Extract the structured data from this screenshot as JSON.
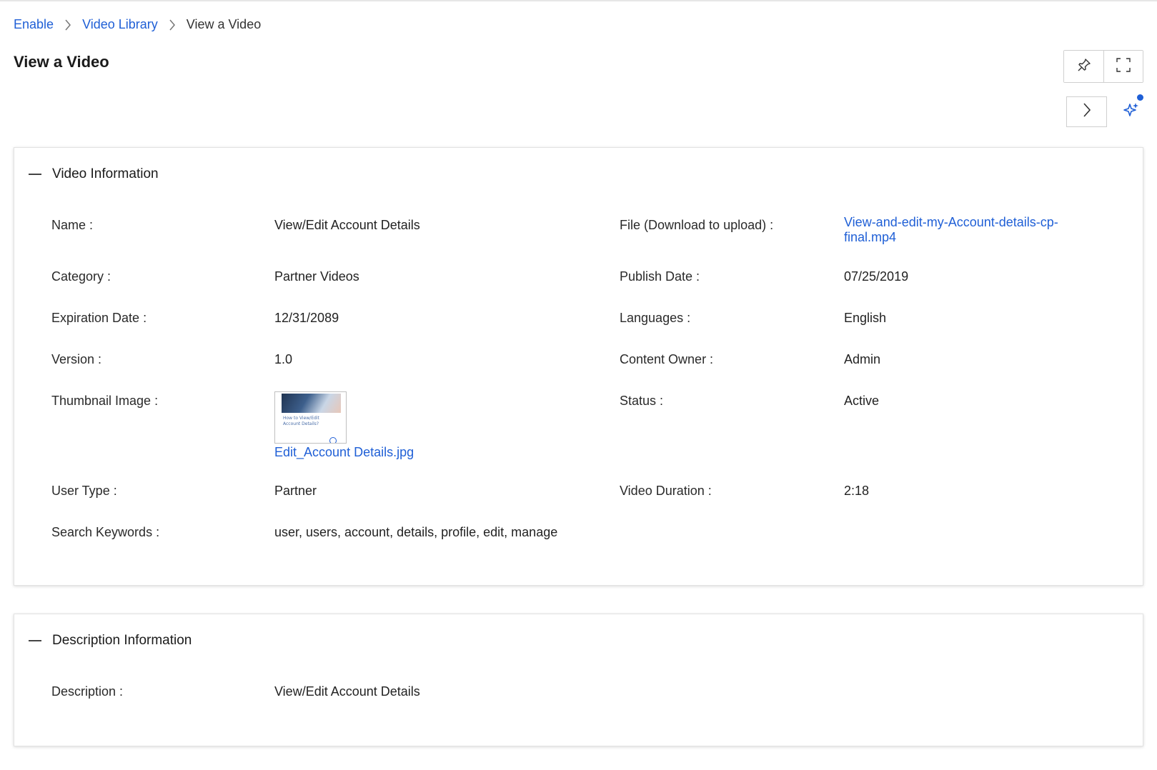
{
  "breadcrumb": {
    "items": [
      {
        "label": "Enable"
      },
      {
        "label": "Video Library"
      },
      {
        "label": "View a Video"
      }
    ]
  },
  "page": {
    "title": "View a Video"
  },
  "toolbar": {
    "icons": [
      "pin-icon",
      "fullscreen-icon",
      "chevron-right-icon",
      "sparkle-icon"
    ],
    "accent": "#1f5fd6"
  },
  "video_section": {
    "title": "Video Information",
    "fields": {
      "name": {
        "label": "Name :",
        "value": "View/Edit Account Details"
      },
      "file": {
        "label": "File (Download to upload) :",
        "value_line1": "View-and-edit-my-Account-details-cp-",
        "value_line2": "final.mp4"
      },
      "category": {
        "label": "Category :",
        "value": "Partner Videos"
      },
      "publish_date": {
        "label": "Publish Date :",
        "value": "07/25/2019"
      },
      "expiration_date": {
        "label": "Expiration Date :",
        "value": "12/31/2089"
      },
      "languages": {
        "label": "Languages :",
        "value": "English"
      },
      "version": {
        "label": "Version :",
        "value": "1.0"
      },
      "content_owner": {
        "label": "Content Owner :",
        "value": "Admin"
      },
      "thumbnail": {
        "label": "Thumbnail Image :",
        "file_name": "Edit_Account Details.jpg",
        "caption_line1": "How to View/Edit",
        "caption_line2": "Account Details?"
      },
      "status": {
        "label": "Status :",
        "value": "Active"
      },
      "user_type": {
        "label": "User Type :",
        "value": "Partner"
      },
      "video_duration": {
        "label": "Video Duration :",
        "value": "2:18"
      },
      "search_keywords": {
        "label": "Search Keywords :",
        "value": "user, users, account, details, profile, edit, manage"
      }
    }
  },
  "description_section": {
    "title": "Description Information",
    "fields": {
      "description": {
        "label": "Description :",
        "value": "View/Edit Account Details"
      }
    }
  }
}
